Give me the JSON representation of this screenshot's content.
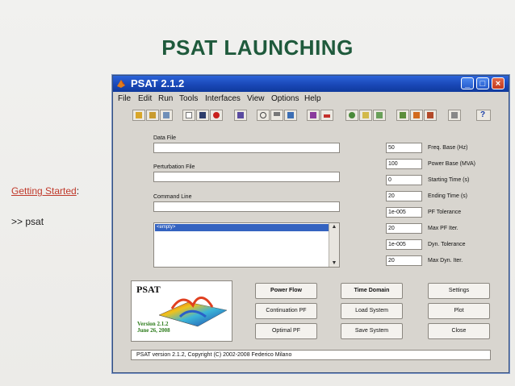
{
  "slide": {
    "title": "PSAT LAUNCHING",
    "getting_started": "Getting Started",
    "colon": ":",
    "command": ">> psat"
  },
  "window": {
    "title": "PSAT 2.1.2",
    "menu": [
      "File",
      "Edit",
      "Run",
      "Tools",
      "Interfaces",
      "View",
      "Options",
      "Help"
    ],
    "fields": {
      "data_file_label": "Data File",
      "perturbation_label": "Perturbation File",
      "command_line_label": "Command Line",
      "list_selected": "<empty>"
    },
    "params": [
      {
        "value": "50",
        "label": "Freq. Base (Hz)"
      },
      {
        "value": "100",
        "label": "Power Base (MVA)"
      },
      {
        "value": "0",
        "label": "Starting Time (s)"
      },
      {
        "value": "20",
        "label": "Ending Time (s)"
      },
      {
        "value": "1e-005",
        "label": "PF Tolerance"
      },
      {
        "value": "20",
        "label": "Max PF Iter."
      },
      {
        "value": "1e-005",
        "label": "Dyn. Tolerance"
      },
      {
        "value": "20",
        "label": "Max Dyn. Iter."
      }
    ],
    "logo": {
      "title": "PSAT",
      "version": "Version 2.1.2",
      "date": "June 26, 2008"
    },
    "buttons": {
      "power_flow": "Power Flow",
      "time_domain": "Time Domain",
      "settings": "Settings",
      "continuation_pf": "Continuation PF",
      "load_system": "Load System",
      "plot": "Plot",
      "optimal_pf": "Optimal PF",
      "save_system": "Save System",
      "close": "Close"
    },
    "status": "PSAT version 2.1.2, Copyright (C) 2002-2008 Federico Milano",
    "toolbar_icons": [
      "open-icon",
      "folder-icon",
      "library-icon",
      "new-icon",
      "save-icon",
      "stop-icon",
      "table-icon",
      "check-icon",
      "network-icon",
      "report-icon",
      "graph-icon",
      "plot-icon",
      "refresh-icon",
      "edit-icon",
      "image-icon",
      "matlab-icon",
      "flag-icon",
      "books-icon",
      "grid-icon",
      "help-icon"
    ],
    "colors": {
      "title_green": "#1f5a3c",
      "link_red": "#c0392b",
      "titlebar_blue": "#1a48b7",
      "window_bg": "#d8d5cf"
    }
  }
}
